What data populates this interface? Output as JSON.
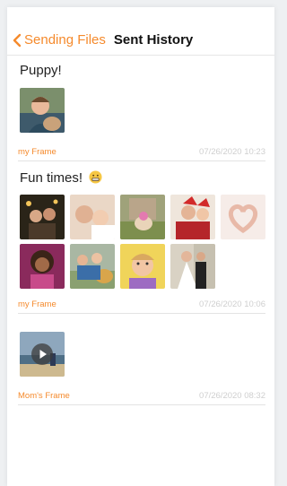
{
  "header": {
    "back_label": "Sending Files",
    "title": "Sent History"
  },
  "posts": [
    {
      "title": "Puppy!",
      "frame": "my Frame",
      "timestamp": "07/26/2020 10:23"
    },
    {
      "title": "Fun times!",
      "emoji": "grimacing-face-emoji",
      "frame": "my Frame",
      "timestamp": "07/26/2020 10:06"
    },
    {
      "title": "",
      "frame": "Mom's Frame",
      "timestamp": "07/26/2020 08:32"
    }
  ],
  "colors": {
    "accent": "#f58a2c",
    "timestamp": "#cfcfcf",
    "divider": "#e3e3e3"
  }
}
